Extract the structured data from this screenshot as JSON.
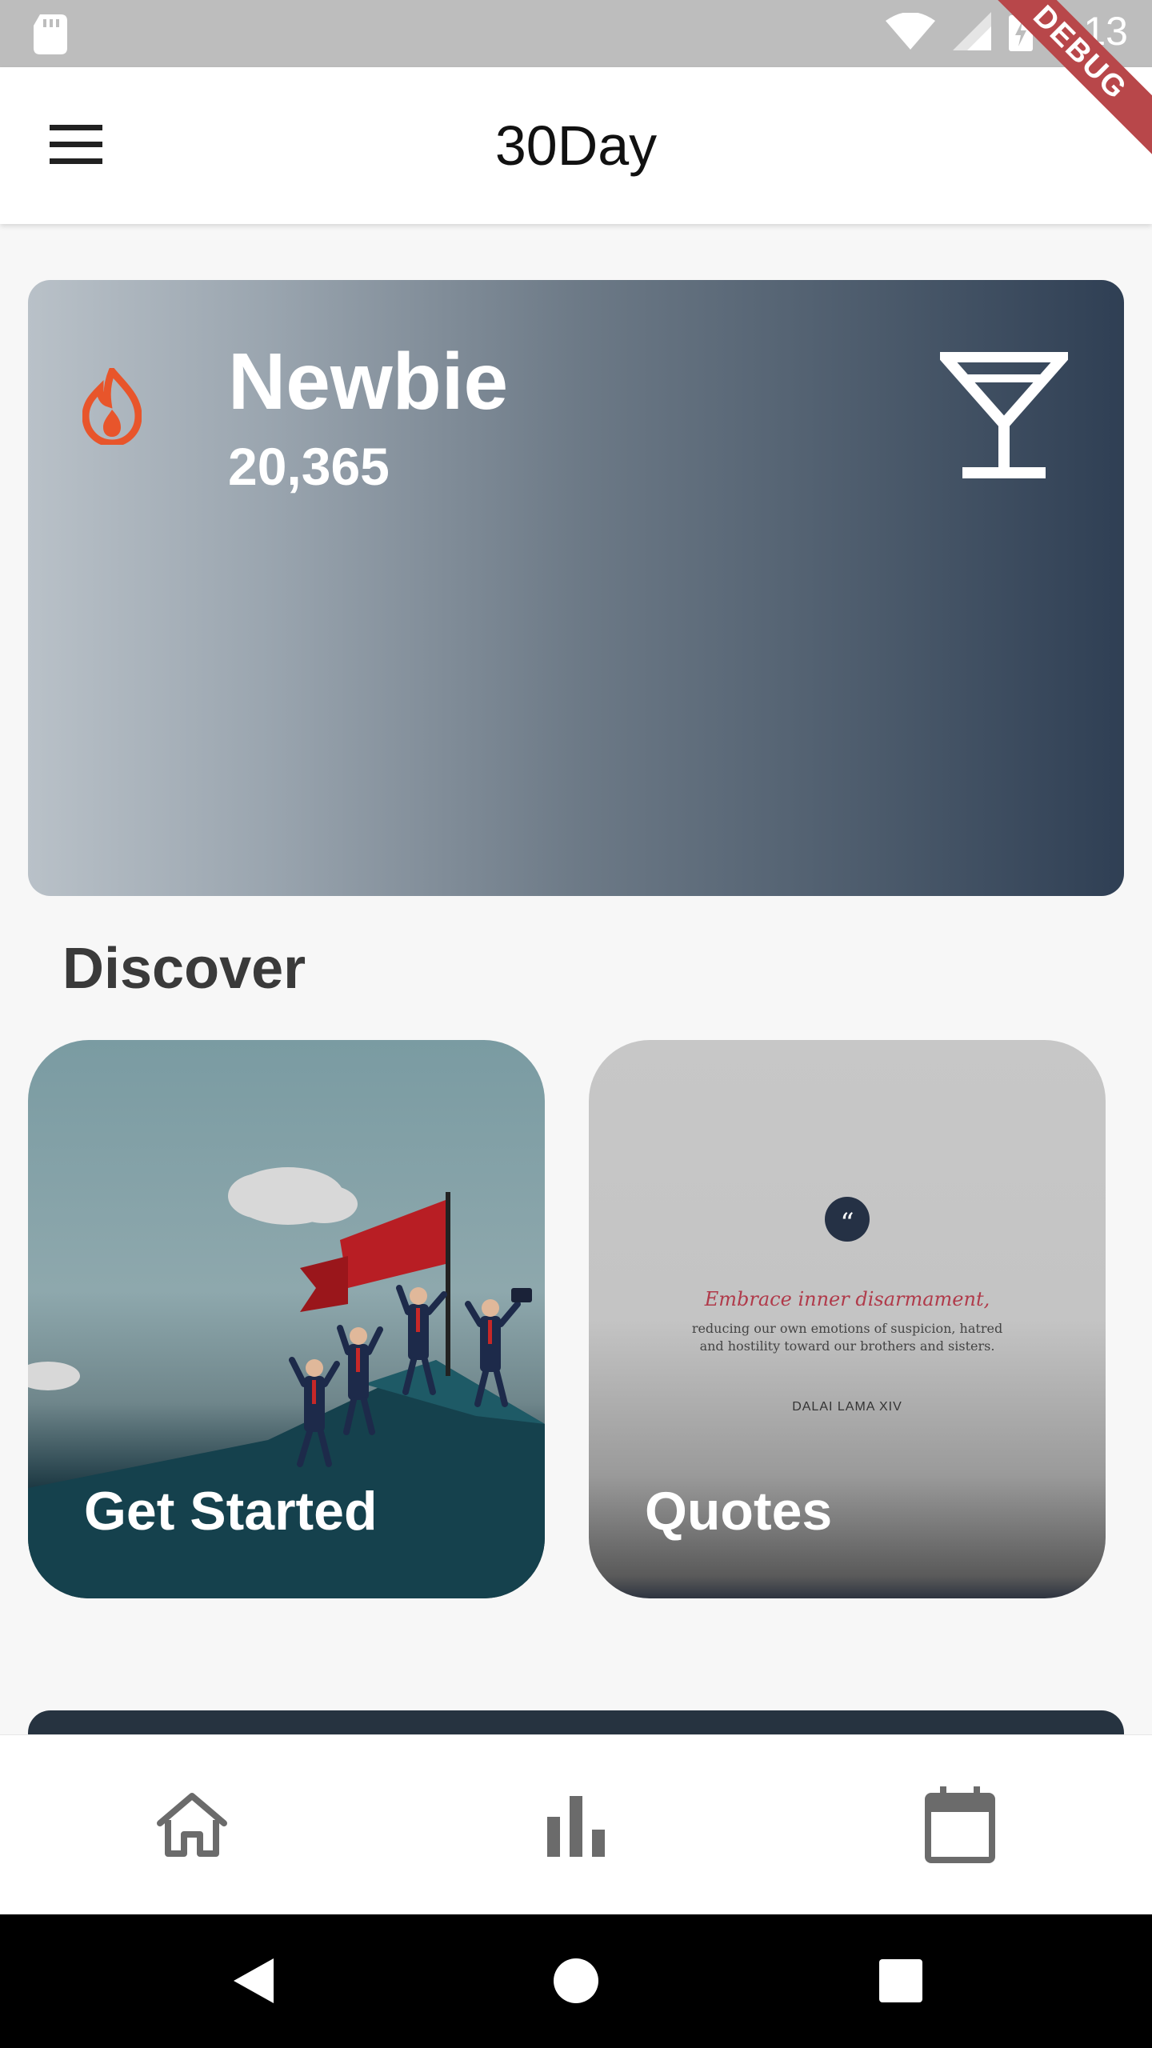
{
  "status_bar": {
    "time": "7:13",
    "debug_label": "DEBUG",
    "icons": [
      "sd-card-icon",
      "wifi-icon",
      "signal-icon",
      "battery-charging-icon"
    ]
  },
  "app_bar": {
    "title": "30Day",
    "menu_icon": "menu-icon"
  },
  "hero": {
    "level_name": "Newbie",
    "points": "20,365",
    "flame_color": "#e8552b",
    "icons": [
      "flame-icon",
      "cocktail-icon"
    ]
  },
  "discover": {
    "heading": "Discover",
    "cards": [
      {
        "label": "Get Started"
      },
      {
        "label": "Quotes",
        "quote_title": "Embrace inner disarmament,",
        "quote_body": "reducing our own emotions of suspicion, hatred and hostility toward our brothers and sisters.",
        "quote_author": "DALAI LAMA XIV"
      }
    ]
  },
  "bottom_nav": {
    "items": [
      "home-icon",
      "stats-icon",
      "calendar-icon"
    ]
  },
  "system_nav": {
    "items": [
      "back-icon",
      "home-circle-icon",
      "recents-icon"
    ]
  }
}
